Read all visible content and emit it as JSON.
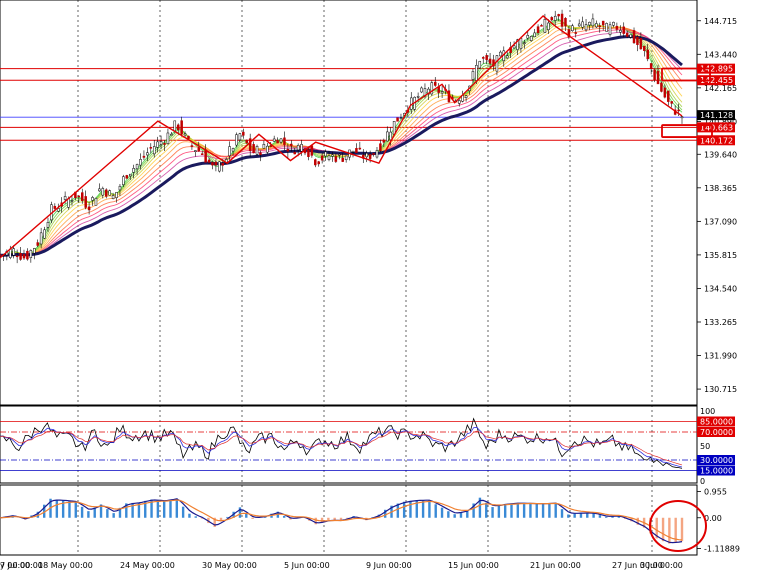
{
  "chart_data": [
    {
      "type": "candlestick",
      "panel": "price",
      "y_ticks": [
        "144.715",
        "143.440",
        "142.165",
        "140.890",
        "139.640",
        "138.365",
        "137.090",
        "135.815",
        "134.540",
        "133.265",
        "131.990",
        "130.715"
      ],
      "ylim": [
        130.3,
        145.2
      ],
      "current_price": "141.128",
      "horizontal_levels": [
        {
          "label": "142.895",
          "value": 142.895,
          "color": "#e00000"
        },
        {
          "label": "142.455",
          "value": 142.455,
          "color": "#e00000"
        },
        {
          "label": "140.663",
          "value": 140.663,
          "color": "#e00000"
        },
        {
          "label": "140.172",
          "value": 140.172,
          "color": "#e00000"
        }
      ],
      "blue_level": 141.05,
      "close_path": [
        [
          0,
          135.8
        ],
        [
          2,
          136.0
        ],
        [
          4,
          135.7
        ],
        [
          6,
          136.3
        ],
        [
          8,
          137.5
        ],
        [
          10,
          137.8
        ],
        [
          12,
          138.1
        ],
        [
          14,
          137.7
        ],
        [
          16,
          138.4
        ],
        [
          18,
          138.0
        ],
        [
          20,
          138.9
        ],
        [
          22,
          139.3
        ],
        [
          24,
          139.9
        ],
        [
          26,
          140.2
        ],
        [
          28,
          140.8
        ],
        [
          30,
          140.0
        ],
        [
          32,
          139.7
        ],
        [
          34,
          139.0
        ],
        [
          36,
          139.6
        ],
        [
          38,
          140.4
        ],
        [
          40,
          139.7
        ],
        [
          42,
          139.9
        ],
        [
          44,
          140.3
        ],
        [
          46,
          139.8
        ],
        [
          48,
          140.0
        ],
        [
          50,
          139.4
        ],
        [
          52,
          139.6
        ],
        [
          54,
          139.5
        ],
        [
          56,
          139.8
        ],
        [
          58,
          139.5
        ],
        [
          60,
          139.9
        ],
        [
          62,
          140.7
        ],
        [
          64,
          141.3
        ],
        [
          66,
          141.8
        ],
        [
          68,
          142.2
        ],
        [
          70,
          142.0
        ],
        [
          72,
          141.7
        ],
        [
          74,
          142.1
        ],
        [
          76,
          143.3
        ],
        [
          78,
          143.0
        ],
        [
          80,
          143.5
        ],
        [
          82,
          143.9
        ],
        [
          84,
          144.2
        ],
        [
          86,
          144.5
        ],
        [
          88,
          144.9
        ],
        [
          90,
          144.3
        ],
        [
          92,
          144.5
        ],
        [
          94,
          144.6
        ],
        [
          96,
          144.4
        ],
        [
          98,
          144.5
        ],
        [
          100,
          144.1
        ],
        [
          102,
          143.5
        ],
        [
          104,
          142.4
        ],
        [
          106,
          141.5
        ],
        [
          108,
          141.1
        ]
      ],
      "zigzag": [
        [
          0,
          135.7
        ],
        [
          25,
          140.9
        ],
        [
          36,
          139.3
        ],
        [
          41,
          140.4
        ],
        [
          46,
          139.4
        ],
        [
          50,
          140.1
        ],
        [
          60,
          139.3
        ],
        [
          65,
          141.5
        ],
        [
          70,
          142.3
        ],
        [
          72,
          141.6
        ],
        [
          86,
          144.9
        ],
        [
          88,
          144.5
        ],
        [
          108,
          141.1
        ]
      ]
    },
    {
      "type": "line",
      "panel": "rsi",
      "y_ticks": [
        "100",
        "50",
        "0"
      ],
      "ylim": [
        0,
        100
      ],
      "levels": [
        {
          "label": "85.0000",
          "value": 85,
          "color": "#e00000"
        },
        {
          "label": "70.0000",
          "value": 70,
          "color": "#e00000"
        },
        {
          "label": "30.0000",
          "value": 30,
          "color": "#0000c0"
        },
        {
          "label": "15.0000",
          "value": 15,
          "color": "#0000c0"
        }
      ]
    },
    {
      "type": "histogram",
      "panel": "macd",
      "y_ticks": [
        "0.955",
        "0.00",
        "-1.11889"
      ],
      "ylim": [
        -1.25,
        1.05
      ]
    }
  ],
  "x_axis_labels": [
    "y 00:00",
    "18 May 00:00",
    "24 May 00:00",
    "30 May 00:00",
    "5 Jun 00:00",
    "9 Jun 00:00",
    "15 Jun 00:00",
    "21 Jun 00:00",
    "27 Jun 00:00",
    "3 Jul 00:00",
    "7 Jul 00:00"
  ],
  "x_axis_days": [
    0,
    16,
    27,
    38,
    49,
    60,
    71,
    82,
    93,
    104,
    114
  ]
}
